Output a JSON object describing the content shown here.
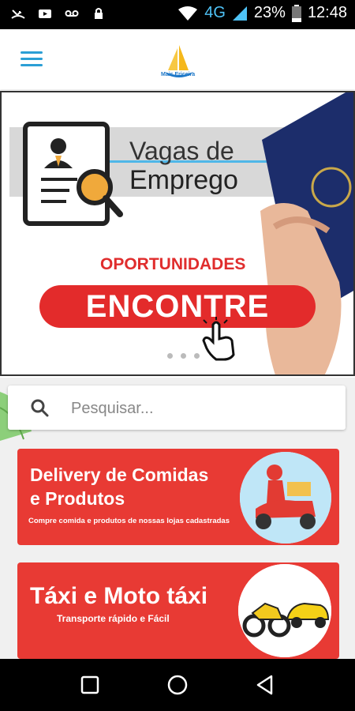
{
  "status_bar": {
    "network": "4G",
    "battery": "23%",
    "time": "12:48",
    "icons": [
      "missed-call-icon",
      "youtube-icon",
      "voicemail-icon",
      "lock-icon",
      "wifi-icon",
      "signal-icon",
      "battery-icon"
    ]
  },
  "app_bar": {
    "menu_icon": "hamburger-icon",
    "logo_text": "Mais Ericeira"
  },
  "banner": {
    "title_line1": "Vagas de",
    "title_line2": "Emprego",
    "subtitle": "OPORTUNIDADES",
    "button": "ENCONTRE",
    "carousel_dots": 3
  },
  "search": {
    "placeholder": "Pesquisar..."
  },
  "cards": [
    {
      "title_line1": "Delivery de Comidas",
      "title_line2": " e Produtos",
      "subtitle": "Compre comida e produtos de nossas lojas cadastradas"
    },
    {
      "title": "Táxi e Moto táxi",
      "subtitle": "Transporte rápido e  Fácil"
    }
  ],
  "nav_bar": {
    "buttons": [
      "recents-square-icon",
      "home-circle-icon",
      "back-triangle-icon"
    ]
  },
  "colors": {
    "accent_blue": "#2b9fd5",
    "card_red": "#e83a34",
    "button_red": "#e32b2b"
  }
}
